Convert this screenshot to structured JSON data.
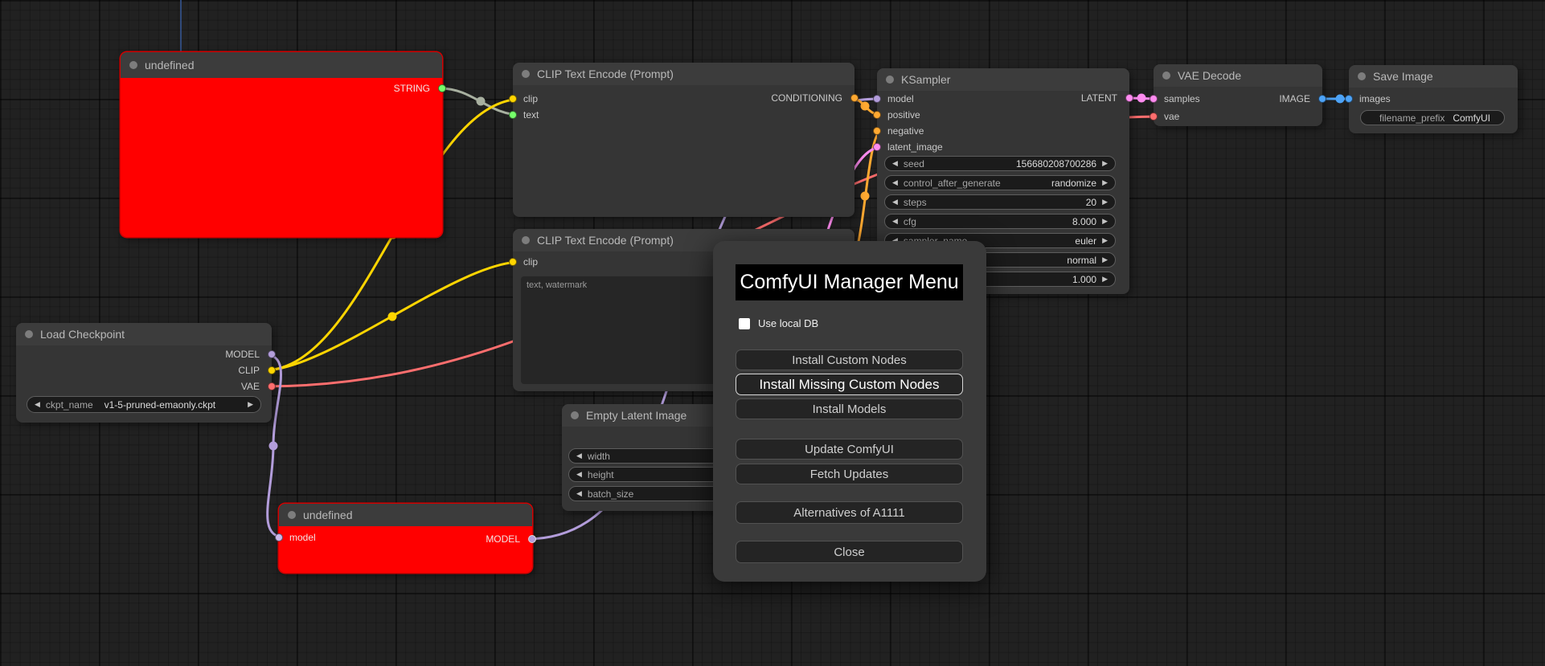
{
  "dialog": {
    "title": "ComfyUI Manager Menu",
    "checkbox_label": "Use local DB",
    "checkbox_checked": false,
    "buttons": [
      "Install Custom Nodes",
      "Install Missing Custom Nodes",
      "Install Models",
      "Update ComfyUI",
      "Fetch Updates",
      "Alternatives of A1111",
      "Close"
    ]
  },
  "nodes": {
    "undefined_top": {
      "title": "undefined",
      "output": "STRING"
    },
    "clip_encode_1": {
      "title": "CLIP Text Encode (Prompt)",
      "inputs": [
        "clip",
        "text"
      ],
      "output": "CONDITIONING"
    },
    "ksampler": {
      "title": "KSampler",
      "inputs": [
        "model",
        "positive",
        "negative",
        "latent_image"
      ],
      "output": "LATENT",
      "widgets": [
        {
          "label": "seed",
          "value": "156680208700286"
        },
        {
          "label": "control_after_generate",
          "value": "randomize"
        },
        {
          "label": "steps",
          "value": "20"
        },
        {
          "label": "cfg",
          "value": "8.000"
        },
        {
          "label": "sampler_name",
          "value": "euler"
        },
        {
          "label": "",
          "value": "normal"
        },
        {
          "label": "",
          "value": "1.000"
        }
      ]
    },
    "vae_decode": {
      "title": "VAE Decode",
      "inputs": [
        "samples",
        "vae"
      ],
      "output": "IMAGE"
    },
    "save_image": {
      "title": "Save Image",
      "inputs": [
        "images"
      ],
      "widget": {
        "label": "filename_prefix",
        "value": "ComfyUI"
      }
    },
    "clip_encode_2": {
      "title": "CLIP Text Encode (Prompt)",
      "inputs": [
        "clip"
      ],
      "text": "text, watermark"
    },
    "load_checkpoint": {
      "title": "Load Checkpoint",
      "outputs": [
        "MODEL",
        "CLIP",
        "VAE"
      ],
      "widget": {
        "label": "ckpt_name",
        "value": "v1-5-pruned-emaonly.ckpt"
      }
    },
    "empty_latent": {
      "title": "Empty Latent Image",
      "widgets": [
        {
          "label": "width"
        },
        {
          "label": "height"
        },
        {
          "label": "batch_size"
        }
      ]
    },
    "undefined_bottom": {
      "title": "undefined",
      "input": "model",
      "output": "MODEL"
    }
  },
  "colors": {
    "model": "#b39ddb",
    "clip": "#ffd500",
    "vae": "#ff6e6e",
    "conditioning": "#ffa931",
    "latent": "#ff8cf0",
    "image": "#4da3f7",
    "string_dot": "#76ff6b",
    "string_wire": "#a8b0a0",
    "error_node": "#ff0000"
  }
}
